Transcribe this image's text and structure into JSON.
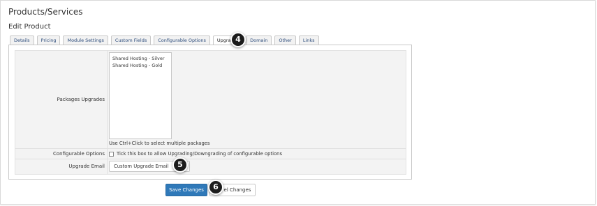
{
  "header": {
    "title": "Products/Services",
    "subtitle": "Edit Product"
  },
  "tabs": [
    {
      "label": "Details"
    },
    {
      "label": "Pricing"
    },
    {
      "label": "Module Settings"
    },
    {
      "label": "Custom Fields"
    },
    {
      "label": "Configurable Options"
    },
    {
      "label": "Upgrades"
    },
    {
      "label": "Domain"
    },
    {
      "label": "Other"
    },
    {
      "label": "Links"
    }
  ],
  "form": {
    "packages_label": "Packages Upgrades",
    "packages_options": [
      "Shared Hosting - Silver",
      "Shared Hosting - Gold"
    ],
    "packages_help": "Use Ctrl+Click to select multiple packages",
    "configurable_label": "Configurable Options",
    "configurable_checkbox_text": "Tick this box to allow Upgrading/Downgrading of configurable options",
    "email_label": "Upgrade Email",
    "email_value": "Custom Upgrade Email"
  },
  "actions": {
    "save_label": "Save Changes",
    "cancel_label": "el Changes"
  },
  "annotations": [
    "4",
    "5",
    "6"
  ],
  "colors": {
    "save_button": "#2f79b9",
    "tab_text": "#2a4a7a",
    "step_badge": "#1c1c1c"
  }
}
